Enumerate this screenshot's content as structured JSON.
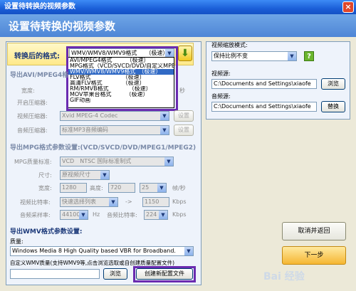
{
  "window": {
    "title": "设置待转换的视频参数",
    "close": "×"
  },
  "banner": {
    "title": "设置待转换的视频参数"
  },
  "format": {
    "label": "转换后的格式:",
    "selected": "WMV/WMV8/WMV9格式　　（极速）",
    "options": [
      "AVI/MPEG4格式　　　（极速）",
      "MPG格式（VCD/SVCD/DVD/自定义MPEG）",
      "WMV/WMV8/WMV9格式　（极速）",
      "FLV格式　　　　　　（极速）",
      "高清FLV格式　　　　（极速）",
      "RM/RMVB格式　　　　（极速）",
      "MOV苹果台格式　　　（极速）",
      "GIF动画"
    ]
  },
  "avi": {
    "title": "导出AVI/MPEG4格",
    "width_label": "宽度:",
    "fps_suffix": "秒",
    "open_compressor": "开启压缩器:",
    "video_compressor_label": "视频压缩器:",
    "video_compressor": "Xvid MPEG-4 Codec",
    "audio_compressor_label": "音频压缩器:",
    "audio_compressor": "标准MP3音频编码",
    "settings": "设置"
  },
  "mpg": {
    "title": "导出MPG格式参数设置:(VCD/SVCD/DVD/MPEG1/MPEG2)",
    "quality_label": "MPG质量标准:",
    "quality": "VCD　NTSC 国际标准制式",
    "size_label": "尺寸:",
    "size": "原视频尺寸",
    "width_label": "宽度:",
    "width": "1280",
    "height_label": "高度:",
    "height": "720",
    "fps": "25",
    "fps_unit": "帧/秒",
    "bitrate_label": "视频比特率:",
    "bitrate": "快速选择列表",
    "arrow": "->",
    "bitrate_value": "1150",
    "bitrate_unit": "Kbps",
    "samplerate_label": "音频采样率:",
    "samplerate": "44100",
    "hz": "Hz",
    "audio_bitrate_label": "音频比特率:",
    "audio_bitrate": "224",
    "audio_unit": "Kbps"
  },
  "wmv": {
    "title": "导出WMV格式参数设置:",
    "quality_label": "质量:",
    "quality": "Windows Media 8 High Quality based VBR for Broadband.",
    "custom_label": "自定义WMV质量(支持WMV9等,点击浏览选取或自创建质量配置文件)",
    "browse": "浏览",
    "create": "创建新配置文件"
  },
  "right": {
    "scale_label": "视频缩放模式:",
    "scale": "保持比例不变",
    "help": "?",
    "video_source_label": "视频源:",
    "video_source": "C:\\Documents and Settings\\xiaofe",
    "browse": "浏览",
    "audio_source_label": "音频源:",
    "audio_source": "C:\\Documents and Settings\\xiaofe",
    "replace": "替换"
  },
  "actions": {
    "cancel": "取消并返回",
    "next": "下一步"
  },
  "watermark": "Bai 经验",
  "colors": {
    "accent": "#6a2bb0",
    "banner": "#4e86d6",
    "selection": "#316ac5"
  }
}
